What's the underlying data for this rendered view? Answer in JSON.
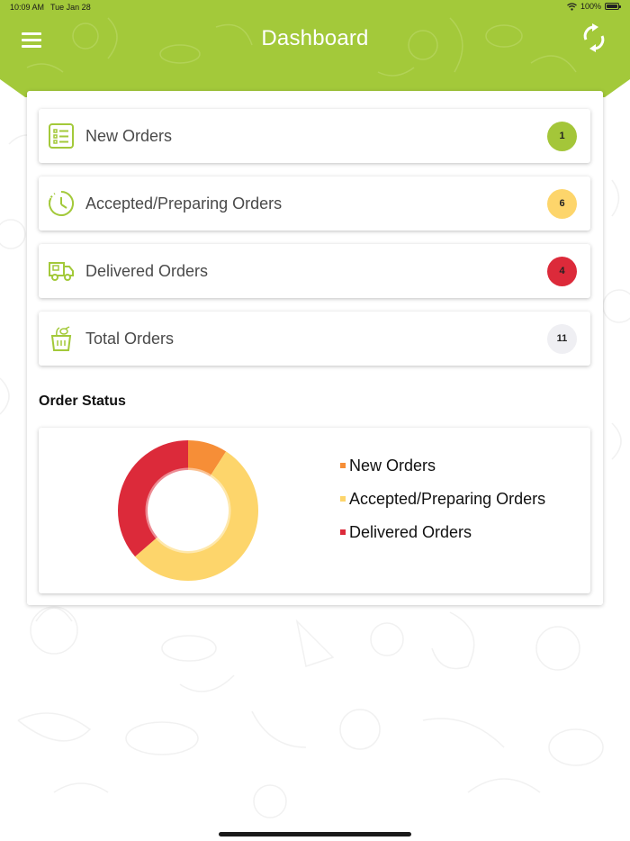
{
  "status_bar": {
    "time": "10:09 AM",
    "date": "Tue Jan 28",
    "battery": "100%"
  },
  "header": {
    "title": "Dashboard",
    "menu_icon": "hamburger-menu-icon",
    "refresh_icon": "refresh-icon",
    "color": "#a3c93a"
  },
  "orders": [
    {
      "label": "New Orders",
      "count": "1",
      "icon": "order-list-icon",
      "badge_color": "#a4c639"
    },
    {
      "label": "Accepted/Preparing Orders",
      "count": "6",
      "icon": "clock-timer-icon",
      "badge_color": "#fdd56b"
    },
    {
      "label": "Delivered Orders",
      "count": "4",
      "icon": "delivery-truck-icon",
      "badge_color": "#dc2a3a"
    },
    {
      "label": "Total Orders",
      "count": "11",
      "icon": "grocery-bag-icon",
      "badge_color": "#efeff3"
    }
  ],
  "order_status": {
    "title": "Order Status"
  },
  "chart_data": {
    "type": "pie",
    "title": "",
    "categories": [
      "New Orders",
      "Accepted/Preparing Orders",
      "Delivered Orders"
    ],
    "values": [
      1,
      6,
      4
    ],
    "colors": [
      "#f68e37",
      "#fdd56b",
      "#dc2a3a"
    ],
    "donut": true,
    "legend_position": "right"
  }
}
